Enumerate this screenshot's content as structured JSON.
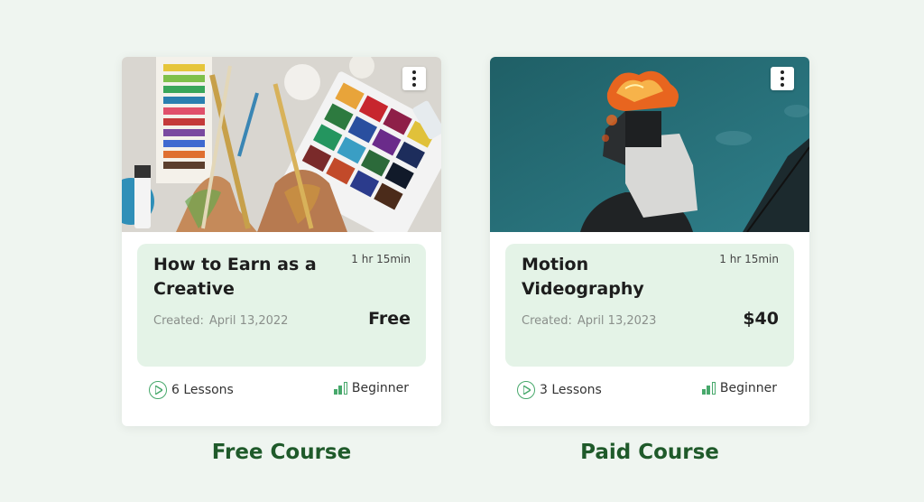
{
  "courses": [
    {
      "title": "How to Earn as a Creative",
      "duration": "1 hr 15min",
      "created_label": "Created:",
      "created_date": "April 13,2022",
      "price": "Free",
      "lessons": "6 Lessons",
      "level": "Beginner",
      "caption": "Free Course",
      "thumbnail_subject": "art-supplies-paint-palette"
    },
    {
      "title": "Motion Videography",
      "duration": "1 hr 15min",
      "created_label": "Created:",
      "created_date": "April 13,2023",
      "price": "$40",
      "lessons": "3 Lessons",
      "level": "Beginner",
      "caption": "Paid Course",
      "thumbnail_subject": "person-with-flaming-head-against-teal-sky"
    }
  ],
  "icons": {
    "menu": "more-vertical-icon",
    "lessons": "play-circle-icon",
    "level": "signal-bars-icon"
  },
  "colors": {
    "page_background": "#eff5f0",
    "info_box": "#e4f3e7",
    "accent_green": "#47a86b",
    "caption_green": "#1f5a2a"
  }
}
